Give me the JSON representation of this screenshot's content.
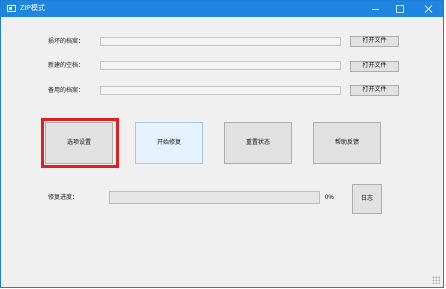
{
  "window": {
    "title": "ZIP模式"
  },
  "icons": {
    "app": "app-window-icon",
    "minimize": "minimize-icon",
    "maximize": "maximize-icon",
    "close": "close-icon"
  },
  "fields": [
    {
      "label": "损坏的档案：",
      "value": "",
      "button": "打开文件"
    },
    {
      "label": "新建的空档：",
      "value": "",
      "button": "打开文件"
    },
    {
      "label": "备用的档案：",
      "value": "",
      "button": "打开文件"
    }
  ],
  "actions": [
    {
      "label": "选项设置"
    },
    {
      "label": "开始修复"
    },
    {
      "label": "重置状态"
    },
    {
      "label": "帮助反馈"
    }
  ],
  "progress": {
    "label": "修复进度：",
    "percent_text": "0%",
    "value": 0
  },
  "log_button": "日志",
  "colors": {
    "titlebar": "#1e86e0",
    "highlight": "#e02020",
    "progress_fill": "#06b025"
  }
}
